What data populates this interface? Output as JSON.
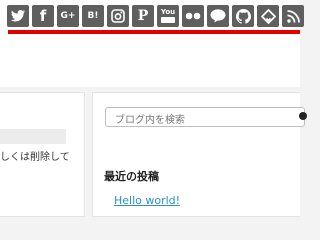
{
  "share_icons": [
    {
      "icon": "twitter-icon",
      "glyph": ""
    },
    {
      "icon": "facebook-icon",
      "glyph": "f"
    },
    {
      "icon": "google-plus-icon",
      "glyph": "G+"
    },
    {
      "icon": "hatena-bookmark-icon",
      "glyph": "B!"
    },
    {
      "icon": "instagram-icon",
      "glyph": ""
    },
    {
      "icon": "pinterest-icon",
      "glyph": "P"
    },
    {
      "icon": "youtube-icon",
      "glyph": "You"
    },
    {
      "icon": "flickr-icon",
      "glyph": ""
    },
    {
      "icon": "line-icon",
      "glyph": "LINE"
    },
    {
      "icon": "github-icon",
      "glyph": ""
    },
    {
      "icon": "feedly-icon",
      "glyph": ""
    },
    {
      "icon": "rss-icon",
      "glyph": ""
    }
  ],
  "colors": {
    "icon_background": "#5f5f5f",
    "accent_line": "#e00000",
    "link": "#2a96c4",
    "page_background": "#f3f3f3"
  },
  "main": {
    "excerpt_text": "しくは削除して"
  },
  "sidebar": {
    "search_placeholder": "ブログ内を検索",
    "recent_posts_title": "最近の投稿",
    "recent_posts": [
      "Hello world!"
    ]
  }
}
